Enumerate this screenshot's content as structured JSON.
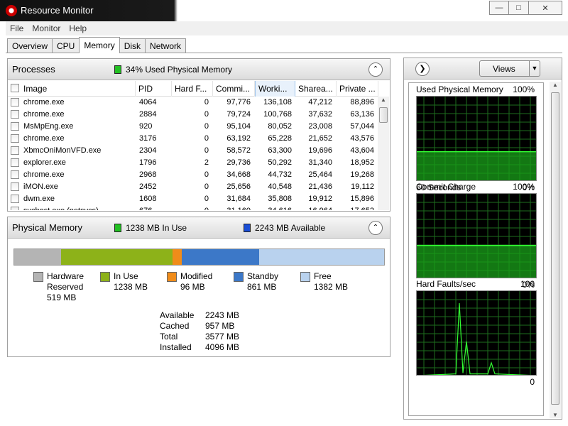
{
  "window": {
    "title": "Resource Monitor",
    "minimize_icon": "minimize-icon",
    "maximize_icon": "maximize-icon",
    "close_icon": "close-icon"
  },
  "menu": [
    "File",
    "Monitor",
    "Help"
  ],
  "tabs": [
    "Overview",
    "CPU",
    "Memory",
    "Disk",
    "Network"
  ],
  "active_tab": "Memory",
  "processes": {
    "title": "Processes",
    "status": "34% Used Physical Memory",
    "status_color": "#22c022",
    "columns": [
      "Image",
      "PID",
      "Hard F...",
      "Commi...",
      "Worki...",
      "Sharea...",
      "Private ..."
    ],
    "sorted_column": "Worki...",
    "rows": [
      {
        "image": "chrome.exe",
        "pid": "4064",
        "hard_faults": "0",
        "commit": "97,776",
        "working": "136,108",
        "shareable": "47,212",
        "private": "88,896"
      },
      {
        "image": "chrome.exe",
        "pid": "2884",
        "hard_faults": "0",
        "commit": "79,724",
        "working": "100,768",
        "shareable": "37,632",
        "private": "63,136"
      },
      {
        "image": "MsMpEng.exe",
        "pid": "920",
        "hard_faults": "0",
        "commit": "95,104",
        "working": "80,052",
        "shareable": "23,008",
        "private": "57,044"
      },
      {
        "image": "chrome.exe",
        "pid": "3176",
        "hard_faults": "0",
        "commit": "63,192",
        "working": "65,228",
        "shareable": "21,652",
        "private": "43,576"
      },
      {
        "image": "XbmcOniMonVFD.exe",
        "pid": "2304",
        "hard_faults": "0",
        "commit": "58,572",
        "working": "63,300",
        "shareable": "19,696",
        "private": "43,604"
      },
      {
        "image": "explorer.exe",
        "pid": "1796",
        "hard_faults": "2",
        "commit": "29,736",
        "working": "50,292",
        "shareable": "31,340",
        "private": "18,952"
      },
      {
        "image": "chrome.exe",
        "pid": "2968",
        "hard_faults": "0",
        "commit": "34,668",
        "working": "44,732",
        "shareable": "25,464",
        "private": "19,268"
      },
      {
        "image": "iMON.exe",
        "pid": "2452",
        "hard_faults": "0",
        "commit": "25,656",
        "working": "40,548",
        "shareable": "21,436",
        "private": "19,112"
      },
      {
        "image": "dwm.exe",
        "pid": "1608",
        "hard_faults": "0",
        "commit": "31,684",
        "working": "35,808",
        "shareable": "19,912",
        "private": "15,896"
      },
      {
        "image": "svchost.exe (netsvcs)",
        "pid": "676",
        "hard_faults": "0",
        "commit": "31,160",
        "working": "34,616",
        "shareable": "16,964",
        "private": "17,652"
      }
    ]
  },
  "physical_memory": {
    "title": "Physical Memory",
    "in_use_status": "1238 MB In Use",
    "available_status": "2243 MB Available",
    "in_use_color": "#22c022",
    "available_color": "#1a4ed6",
    "segments": [
      {
        "name": "Hardware Reserved",
        "mb": 519,
        "color": "#b4b4b4"
      },
      {
        "name": "In Use",
        "mb": 1238,
        "color": "#8db219"
      },
      {
        "name": "Modified",
        "mb": 96,
        "color": "#f08c1a"
      },
      {
        "name": "Standby",
        "mb": 861,
        "color": "#3c78c8"
      },
      {
        "name": "Free",
        "mb": 1382,
        "color": "#b9d2ee"
      }
    ],
    "legend": [
      {
        "line1": "Hardware",
        "line2": "Reserved",
        "line3": "519 MB"
      },
      {
        "line1": "In Use",
        "line2": "1238 MB",
        "line3": ""
      },
      {
        "line1": "Modified",
        "line2": "96 MB",
        "line3": ""
      },
      {
        "line1": "Standby",
        "line2": "861 MB",
        "line3": ""
      },
      {
        "line1": "Free",
        "line2": "1382 MB",
        "line3": ""
      }
    ],
    "stats": [
      {
        "label": "Available",
        "value": "2243 MB"
      },
      {
        "label": "Cached",
        "value": "957 MB"
      },
      {
        "label": "Total",
        "value": "3577 MB"
      },
      {
        "label": "Installed",
        "value": "4096 MB"
      }
    ]
  },
  "right_pane": {
    "views_label": "Views",
    "graphs": [
      {
        "title": "Used Physical Memory",
        "max": "100%",
        "footer_left": "60 Seconds",
        "footer_right": "0%",
        "level": 0.34
      },
      {
        "title": "Commit Charge",
        "max": "100%",
        "footer_left": "",
        "footer_right": "0%",
        "level": 0.4
      },
      {
        "title": "Hard Faults/sec",
        "max": "100",
        "footer_left": "",
        "footer_right": "0",
        "level": 0.0
      }
    ]
  }
}
